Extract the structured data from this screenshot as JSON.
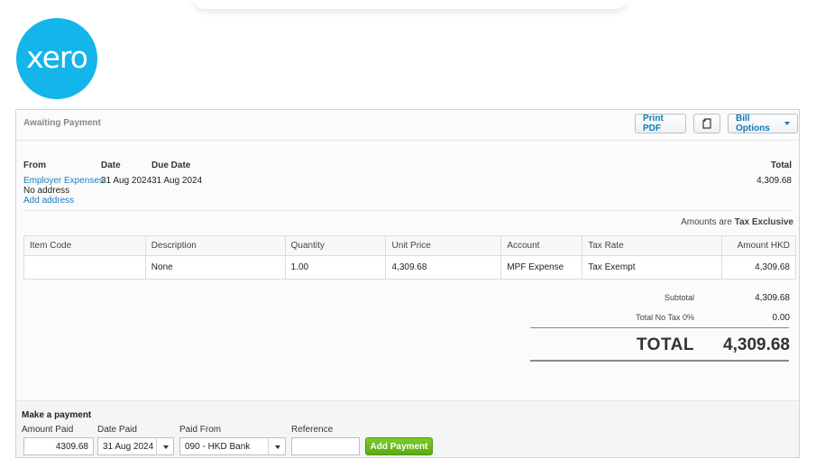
{
  "brand": {
    "logo_text": "xero",
    "color": "#13b5ea"
  },
  "header": {
    "status": "Awaiting Payment",
    "print_pdf": "Print PDF",
    "bill_options": "Bill Options"
  },
  "bill": {
    "from_label": "From",
    "date_label": "Date",
    "due_date_label": "Due Date",
    "total_label": "Total",
    "from_name": "Employer Expenses",
    "date": "31 Aug 2024",
    "due_date": "31 Aug 2024",
    "no_address": "No address",
    "add_address": "Add address",
    "total": "4,309.68",
    "amounts_prefix": "Amounts are",
    "amounts_mode": "Tax Exclusive"
  },
  "table": {
    "headers": [
      "Item Code",
      "Description",
      "Quantity",
      "Unit Price",
      "Account",
      "Tax Rate",
      "Amount HKD"
    ],
    "rows": [
      [
        "",
        "None",
        "1.00",
        "4,309.68",
        "MPF Expense",
        "Tax Exempt",
        "4,309.68"
      ]
    ]
  },
  "summary": {
    "subtotal_label": "Subtotal",
    "subtotal": "4,309.68",
    "tax_label": "Total No Tax 0%",
    "tax": "0.00",
    "total_label": "TOTAL",
    "total": "4,309.68"
  },
  "payment": {
    "title": "Make a payment",
    "amount_paid_label": "Amount Paid",
    "amount_paid": "4309.68",
    "date_paid_label": "Date Paid",
    "date_paid": "31 Aug 2024",
    "paid_from_label": "Paid From",
    "paid_from": "090 - HKD Bank",
    "reference_label": "Reference",
    "reference": "",
    "add_payment": "Add Payment"
  }
}
